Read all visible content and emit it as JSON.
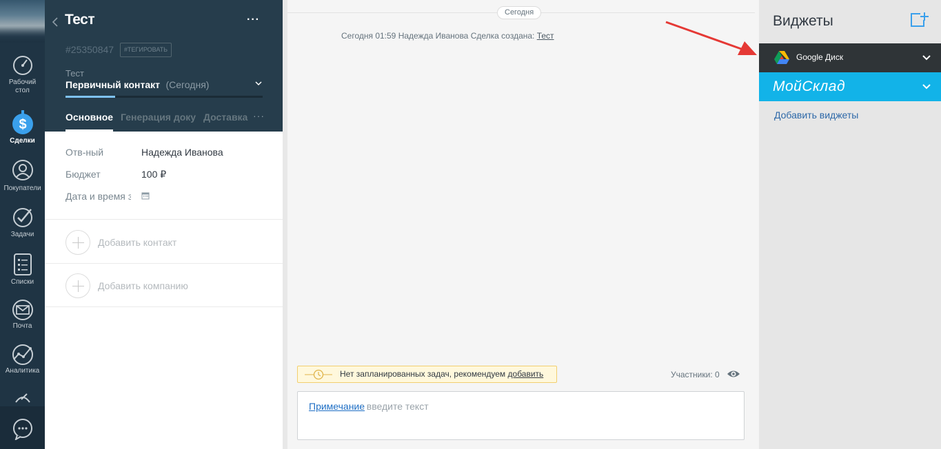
{
  "nav": {
    "items": [
      {
        "label_line1": "Рабочий",
        "label_line2": "стол",
        "icon": "dashboard-icon"
      },
      {
        "label": "Сделки",
        "icon": "deals-dollar-icon",
        "active": true
      },
      {
        "label": "Покупатели",
        "icon": "customers-icon"
      },
      {
        "label": "Задачи",
        "icon": "tasks-check-icon"
      },
      {
        "label": "Списки",
        "icon": "lists-icon"
      },
      {
        "label": "Почта",
        "icon": "mail-icon"
      },
      {
        "label": "Аналитика",
        "icon": "analytics-icon"
      }
    ],
    "chat_icon": "chat-bubble-icon"
  },
  "card": {
    "title": "Тест",
    "deal_id": "#25350847",
    "tag_button": "#ТЕГИРОВАТЬ",
    "pipeline_label": "Тест",
    "stage": "Первичный контакт",
    "stage_date": "(Сегодня)",
    "stage_progress": 0.25,
    "tabs": [
      "Основное",
      "Генерация доку",
      "Доставка"
    ],
    "tab_more": "···",
    "fields": [
      {
        "label": "Отв-ный",
        "value": "Надежда Иванова"
      },
      {
        "label": "Бюджет",
        "value": "100 ₽"
      },
      {
        "label": "Дата и время з",
        "value": ""
      }
    ],
    "add_contact": "Добавить контакт",
    "add_company": "Добавить компанию"
  },
  "feed": {
    "date_chip": "Сегодня",
    "event": {
      "text": "Сегодня 01:59 Надежда Иванова  Сделка создана: ",
      "link": "Тест"
    },
    "task_warning": {
      "text": "Нет запланированных задач, рекомендуем ",
      "link": "добавить"
    },
    "participants": "Участники: 0",
    "note": {
      "label": "Примечание",
      "placeholder": ": введите текст"
    }
  },
  "widgets": {
    "title": "Виджеты",
    "items": [
      {
        "label": "Google Диск",
        "icon": "google-drive-icon"
      },
      {
        "label": "МойСклад",
        "icon": "moysklad-logo"
      }
    ],
    "add_link": "Добавить виджеты"
  },
  "colors": {
    "nav_bg": "#1f3444",
    "card_header_bg": "#263d4c",
    "google_drive_row": "#2f3437",
    "moysklad_row": "#12b3e8",
    "annotation_arrow": "#e53935"
  }
}
